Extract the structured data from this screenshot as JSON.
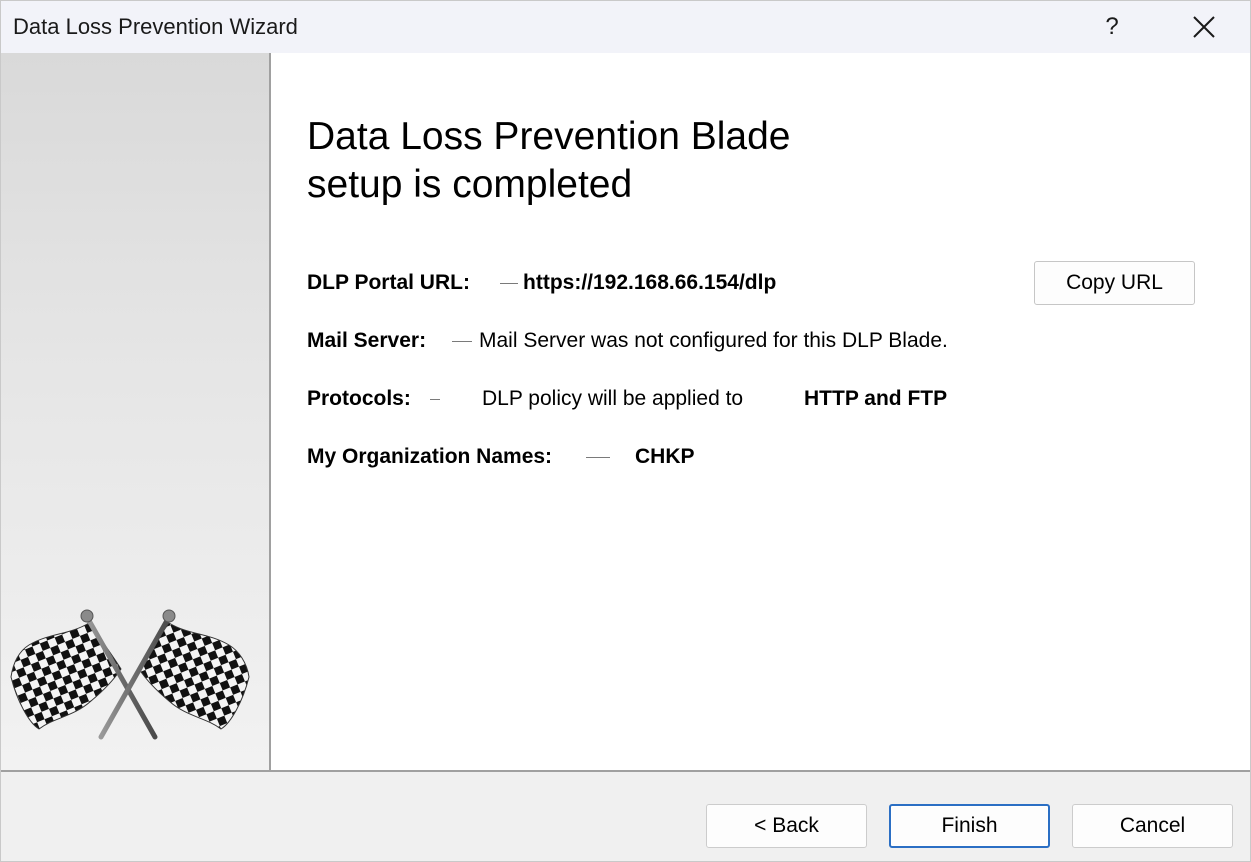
{
  "window": {
    "title": "Data Loss Prevention Wizard",
    "help_label": "?"
  },
  "icons": {
    "help": "question-mark",
    "close": "close-x",
    "side_graphic": "checkered-flags"
  },
  "heading": {
    "line1": "Data Loss Prevention Blade",
    "line2": "setup is completed"
  },
  "summary": {
    "portal_url": {
      "label": "DLP Portal URL:",
      "value": "https://192.168.66.154/dlp"
    },
    "mail_server": {
      "label": "Mail Server:",
      "value": "Mail Server was not configured for this DLP Blade."
    },
    "protocols": {
      "label": "Protocols:",
      "prefix": "DLP policy will be applied to",
      "value": "HTTP and FTP"
    },
    "org_names": {
      "label": "My Organization Names:",
      "value": "CHKP"
    }
  },
  "buttons": {
    "copy_url": "Copy URL",
    "back": "< Back",
    "finish": "Finish",
    "cancel": "Cancel"
  },
  "colors": {
    "titlebar": "#f2f3f9",
    "footer": "#f0f0f0",
    "default_button_border": "#2b6fc4"
  }
}
